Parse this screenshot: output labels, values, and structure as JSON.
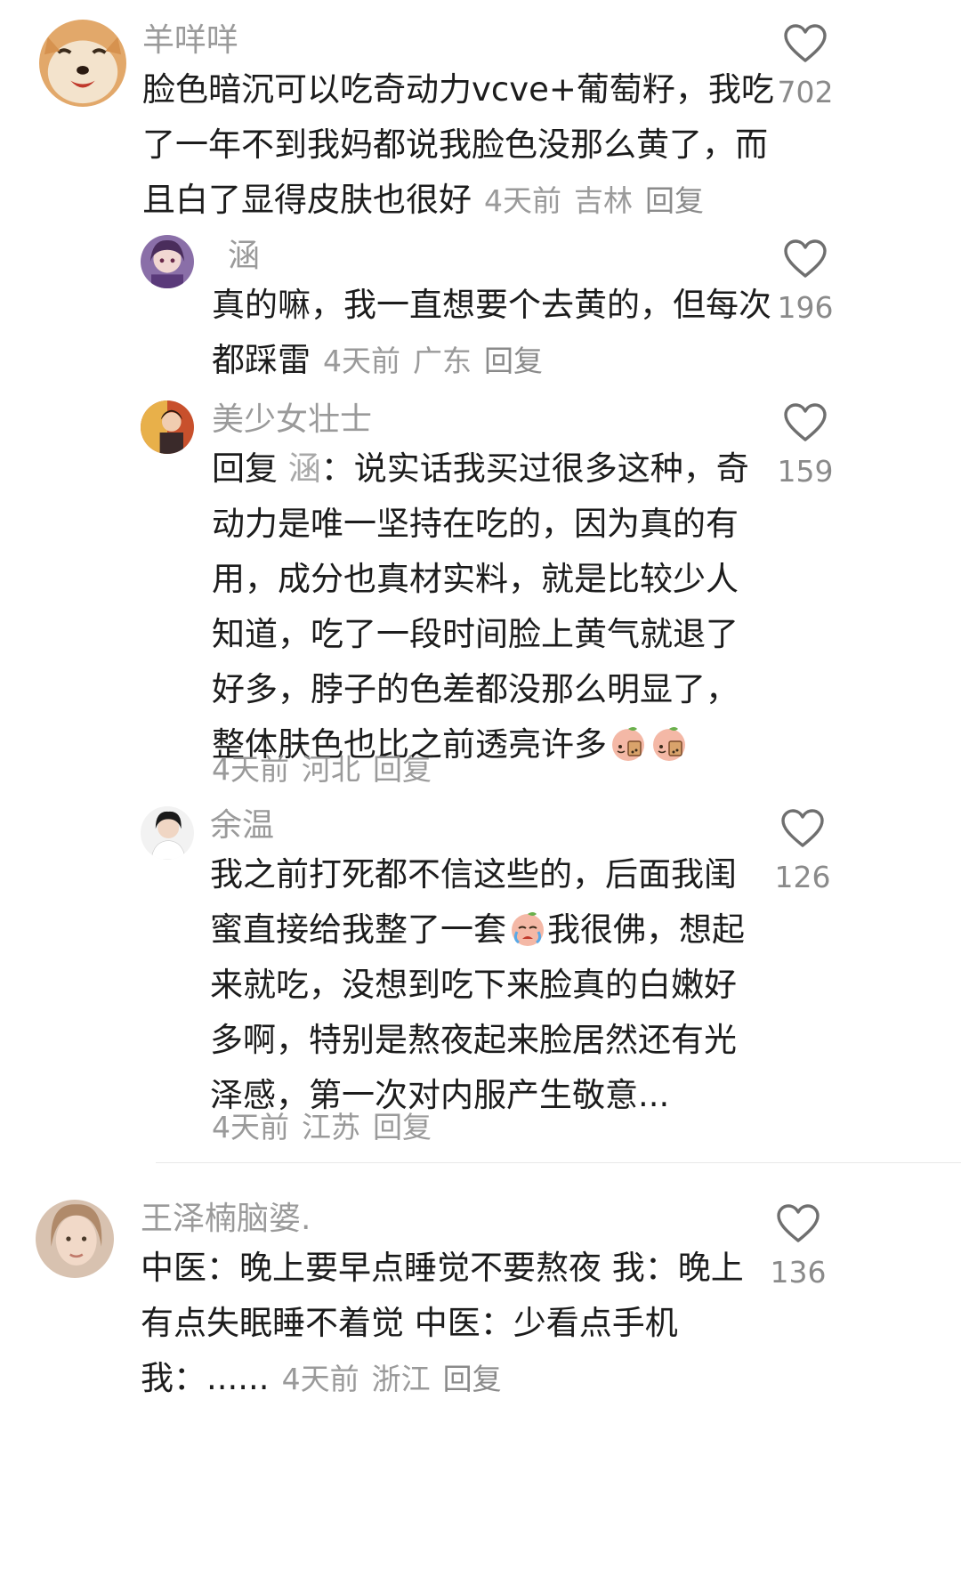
{
  "comments": [
    {
      "username": "羊咩咩",
      "lines": [
        "脸色暗沉可以吃奇动力vcve+葡萄籽，我吃",
        "了一年不到我妈都说我脸色没那么黄了，而",
        "且白了显得皮肤也很好"
      ],
      "time": "4天前",
      "location": "吉林",
      "reply_label": "回复",
      "likes": "702"
    },
    {
      "username": "涵",
      "lines": [
        "真的嘛，我一直想要个去黄的，但每次",
        "都踩雷"
      ],
      "time": "4天前",
      "location": "广东",
      "reply_label": "回复",
      "likes": "196"
    },
    {
      "username": "美少女壮士",
      "reply_prefix": "回复",
      "reply_target": "涵",
      "lines": [
        "：说实话我买过很多这种，奇",
        "动力是唯一坚持在吃的，因为真的有",
        "用，成分也真材实料，就是比较少人",
        "知道，吃了一段时间脸上黄气就退了",
        "好多，脖子的色差都没那么明显了，",
        "整体肤色也比之前透亮许多"
      ],
      "time": "4天前",
      "location": "河北",
      "reply_label": "回复",
      "likes": "159"
    },
    {
      "username": "余温",
      "lines": [
        "我之前打死都不信这些的，后面我闺",
        "蜜直接给我整了一套",
        "我很佛，想起",
        "来就吃，没想到吃下来脸真的白嫩好",
        "多啊，特别是熬夜起来脸居然还有光",
        "泽感，第一次对内服产生敬意..."
      ],
      "time": "4天前",
      "location": "江苏",
      "reply_label": "回复",
      "likes": "126"
    },
    {
      "username": "王泽楠脑婆.",
      "lines": [
        "中医：晚上要早点睡觉不要熬夜 我：晚上",
        "有点失眠睡不着觉 中医：少看点手机",
        "我：......"
      ],
      "time": "4天前",
      "location": "浙江",
      "reply_label": "回复",
      "likes": "136"
    }
  ],
  "icons": {
    "like": "heart-outline-icon",
    "emoji_tea": "milk-tea-peach-emoji",
    "emoji_cry": "crying-peach-emoji"
  },
  "colors": {
    "username": "#9a9a9a",
    "text": "#1c1c1c",
    "meta": "#9a9a9a"
  }
}
